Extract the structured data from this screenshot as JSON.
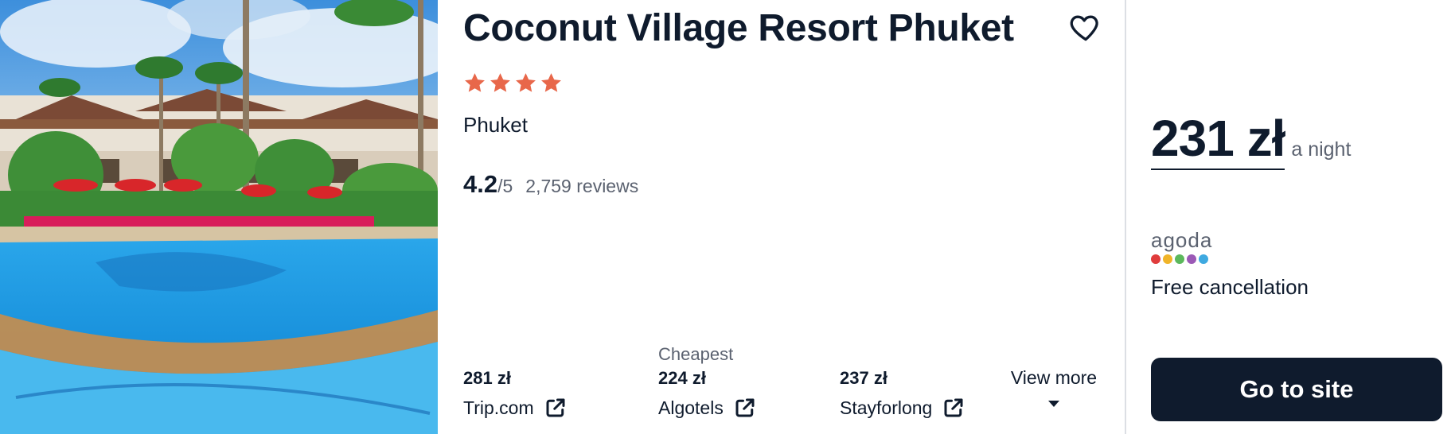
{
  "hotel": {
    "name": "Coconut Village Resort Phuket",
    "star_count": 4,
    "star_color": "#e8674a",
    "location": "Phuket",
    "rating_score": "4.2",
    "rating_max": "/5",
    "reviews": "2,759 reviews",
    "favorite_icon": "heart-outline-icon"
  },
  "offers": [
    {
      "price": "281 zł",
      "provider": "Trip.com",
      "tag": "",
      "icon": "external-link-icon"
    },
    {
      "price": "224 zł",
      "provider": "Algotels",
      "tag": "Cheapest",
      "icon": "external-link-icon"
    },
    {
      "price": "237 zł",
      "provider": "Stayforlong",
      "tag": "",
      "icon": "external-link-icon"
    }
  ],
  "view_more": {
    "label": "View more",
    "icon": "caret-down-icon"
  },
  "main_offer": {
    "price": "231 zł",
    "unit": "a night",
    "partner": "agoda",
    "partner_dot_colors": [
      "#e03c3c",
      "#f0b429",
      "#5cb85c",
      "#9b59b6",
      "#3fa9e0"
    ],
    "cancellation": "Free cancellation",
    "cta_label": "Go to site",
    "cta_color": "#0f1b2d"
  }
}
